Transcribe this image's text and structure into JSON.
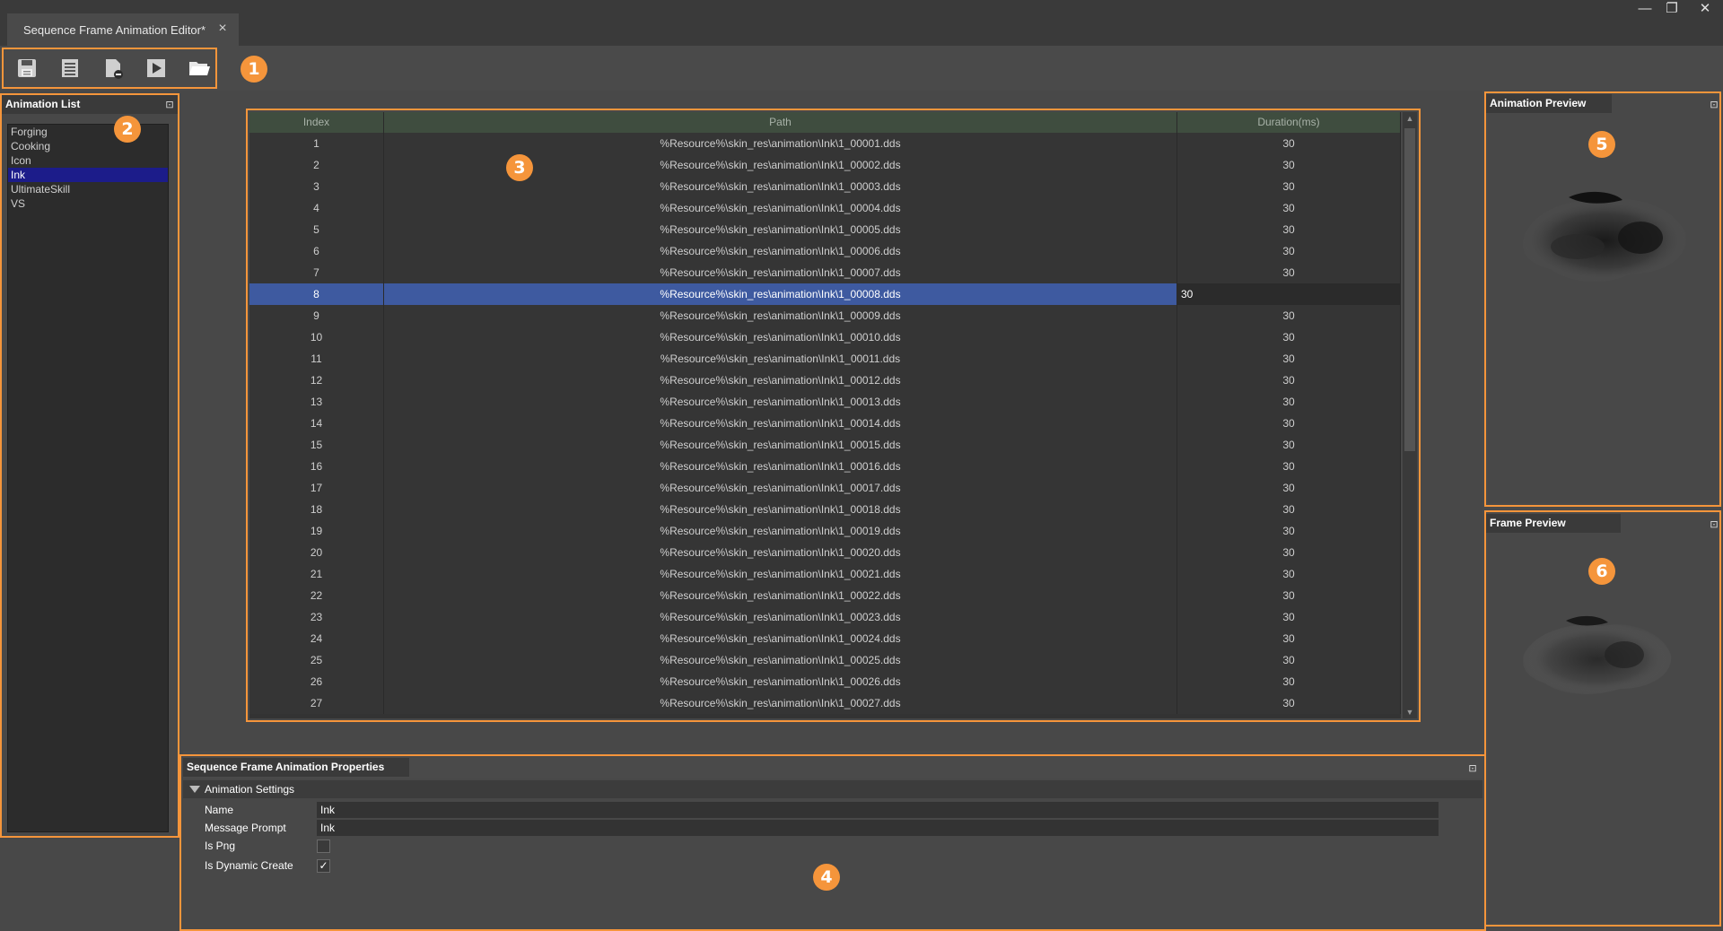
{
  "window": {
    "tab_title": "Sequence Frame Animation Editor*",
    "close_glyph": "×",
    "minimize_glyph": "—",
    "restore_glyph": "❐",
    "window_close_glyph": "✕"
  },
  "toolbar": {
    "buttons": [
      "save-icon",
      "list-icon",
      "remove-file-icon",
      "play-icon",
      "open-folder-icon"
    ]
  },
  "callouts": [
    "1",
    "2",
    "3",
    "4",
    "5",
    "6"
  ],
  "animation_list": {
    "title": "Animation List",
    "items": [
      "Forging",
      "Cooking",
      "Icon",
      "Ink",
      "UltimateSkill",
      "VS"
    ],
    "selected_index": 3
  },
  "table": {
    "headers": {
      "index": "Index",
      "path": "Path",
      "duration": "Duration(ms)"
    },
    "selected_index": 8,
    "rows": [
      {
        "index": "1",
        "path": "%Resource%\\skin_res\\animation\\Ink\\1_00001.dds",
        "duration": "30"
      },
      {
        "index": "2",
        "path": "%Resource%\\skin_res\\animation\\Ink\\1_00002.dds",
        "duration": "30"
      },
      {
        "index": "3",
        "path": "%Resource%\\skin_res\\animation\\Ink\\1_00003.dds",
        "duration": "30"
      },
      {
        "index": "4",
        "path": "%Resource%\\skin_res\\animation\\Ink\\1_00004.dds",
        "duration": "30"
      },
      {
        "index": "5",
        "path": "%Resource%\\skin_res\\animation\\Ink\\1_00005.dds",
        "duration": "30"
      },
      {
        "index": "6",
        "path": "%Resource%\\skin_res\\animation\\Ink\\1_00006.dds",
        "duration": "30"
      },
      {
        "index": "7",
        "path": "%Resource%\\skin_res\\animation\\Ink\\1_00007.dds",
        "duration": "30"
      },
      {
        "index": "8",
        "path": "%Resource%\\skin_res\\animation\\Ink\\1_00008.dds",
        "duration": "30"
      },
      {
        "index": "9",
        "path": "%Resource%\\skin_res\\animation\\Ink\\1_00009.dds",
        "duration": "30"
      },
      {
        "index": "10",
        "path": "%Resource%\\skin_res\\animation\\Ink\\1_00010.dds",
        "duration": "30"
      },
      {
        "index": "11",
        "path": "%Resource%\\skin_res\\animation\\Ink\\1_00011.dds",
        "duration": "30"
      },
      {
        "index": "12",
        "path": "%Resource%\\skin_res\\animation\\Ink\\1_00012.dds",
        "duration": "30"
      },
      {
        "index": "13",
        "path": "%Resource%\\skin_res\\animation\\Ink\\1_00013.dds",
        "duration": "30"
      },
      {
        "index": "14",
        "path": "%Resource%\\skin_res\\animation\\Ink\\1_00014.dds",
        "duration": "30"
      },
      {
        "index": "15",
        "path": "%Resource%\\skin_res\\animation\\Ink\\1_00015.dds",
        "duration": "30"
      },
      {
        "index": "16",
        "path": "%Resource%\\skin_res\\animation\\Ink\\1_00016.dds",
        "duration": "30"
      },
      {
        "index": "17",
        "path": "%Resource%\\skin_res\\animation\\Ink\\1_00017.dds",
        "duration": "30"
      },
      {
        "index": "18",
        "path": "%Resource%\\skin_res\\animation\\Ink\\1_00018.dds",
        "duration": "30"
      },
      {
        "index": "19",
        "path": "%Resource%\\skin_res\\animation\\Ink\\1_00019.dds",
        "duration": "30"
      },
      {
        "index": "20",
        "path": "%Resource%\\skin_res\\animation\\Ink\\1_00020.dds",
        "duration": "30"
      },
      {
        "index": "21",
        "path": "%Resource%\\skin_res\\animation\\Ink\\1_00021.dds",
        "duration": "30"
      },
      {
        "index": "22",
        "path": "%Resource%\\skin_res\\animation\\Ink\\1_00022.dds",
        "duration": "30"
      },
      {
        "index": "23",
        "path": "%Resource%\\skin_res\\animation\\Ink\\1_00023.dds",
        "duration": "30"
      },
      {
        "index": "24",
        "path": "%Resource%\\skin_res\\animation\\Ink\\1_00024.dds",
        "duration": "30"
      },
      {
        "index": "25",
        "path": "%Resource%\\skin_res\\animation\\Ink\\1_00025.dds",
        "duration": "30"
      },
      {
        "index": "26",
        "path": "%Resource%\\skin_res\\animation\\Ink\\1_00026.dds",
        "duration": "30"
      },
      {
        "index": "27",
        "path": "%Resource%\\skin_res\\animation\\Ink\\1_00027.dds",
        "duration": "30"
      }
    ]
  },
  "properties": {
    "title": "Sequence Frame Animation Properties",
    "section": "Animation Settings",
    "name_label": "Name",
    "name_value": "Ink",
    "message_prompt_label": "Message Prompt",
    "message_prompt_value": "Ink",
    "is_png_label": "Is Png",
    "is_png_checked": false,
    "is_dynamic_create_label": "Is Dynamic Create",
    "is_dynamic_create_checked": true,
    "check_glyph": "✓"
  },
  "animation_preview": {
    "title": "Animation Preview"
  },
  "frame_preview": {
    "title": "Frame Preview"
  },
  "colors": {
    "accent": "#f5953b",
    "selection_list": "#1c1c8a",
    "selection_row": "#3e5aa0"
  }
}
